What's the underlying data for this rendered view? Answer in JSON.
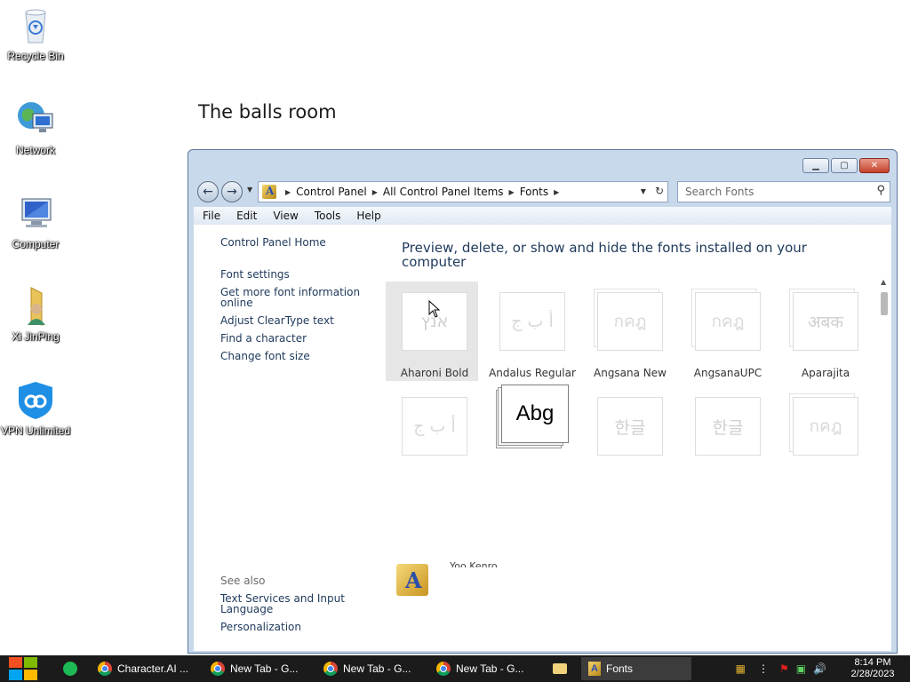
{
  "desktop": {
    "icons": [
      {
        "label": "Recycle Bin"
      },
      {
        "label": "Network"
      },
      {
        "label": "Computer"
      },
      {
        "label": "Xi JinPing"
      },
      {
        "label": "VPN Unlimited"
      }
    ],
    "wallpaper_text": "The balls room"
  },
  "window": {
    "address": {
      "crumbs": [
        "Control Panel",
        "All Control Panel Items",
        "Fonts"
      ]
    },
    "search": {
      "placeholder": "Search Fonts"
    },
    "menu": [
      "File",
      "Edit",
      "View",
      "Tools",
      "Help"
    ],
    "sidebar": {
      "home": "Control Panel Home",
      "links": [
        "Font settings",
        "Get more font information online",
        "Adjust ClearType text",
        "Find a character",
        "Change font size"
      ],
      "see_also_title": "See also",
      "see_also": [
        "Text Services and Input Language",
        "Personalization"
      ]
    },
    "main": {
      "title": "Preview, delete, or show and hide the fonts installed on your computer",
      "fonts_row1": [
        {
          "name": "Aharoni Bold",
          "sample": "אנץ"
        },
        {
          "name": "Andalus Regular",
          "sample": "أ ب ج"
        },
        {
          "name": "Angsana New",
          "sample": "กคฎ"
        },
        {
          "name": "AngsanaUPC",
          "sample": "กคฎ"
        },
        {
          "name": "Aparajita",
          "sample": "अबक"
        }
      ],
      "fonts_row2": [
        {
          "name": "",
          "sample": "أ ب ج"
        },
        {
          "name": "",
          "sample": "Abg"
        },
        {
          "name": "",
          "sample": "한글"
        },
        {
          "name": "",
          "sample": "한글"
        },
        {
          "name": "",
          "sample": "กคฎ"
        }
      ],
      "bottom_partial_label": "Yoo Kenro"
    }
  },
  "taskbar": {
    "apps": [
      {
        "label": "Character.AI ..."
      },
      {
        "label": "New Tab - G..."
      },
      {
        "label": "New Tab - G..."
      },
      {
        "label": "New Tab - G..."
      },
      {
        "label": "Fonts"
      }
    ],
    "clock": {
      "time": "8:14 PM",
      "date": "2/28/2023"
    }
  }
}
